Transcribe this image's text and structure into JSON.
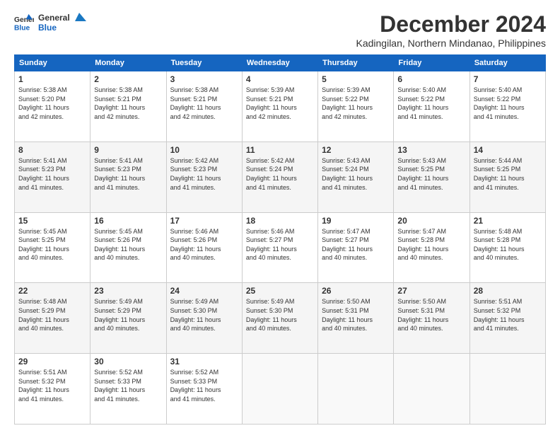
{
  "header": {
    "logo": {
      "line1": "General",
      "line2": "Blue"
    },
    "title": "December 2024",
    "subtitle": "Kadingilan, Northern Mindanao, Philippines"
  },
  "calendar": {
    "days_of_week": [
      "Sunday",
      "Monday",
      "Tuesday",
      "Wednesday",
      "Thursday",
      "Friday",
      "Saturday"
    ],
    "weeks": [
      [
        {
          "day": "1",
          "info": "Sunrise: 5:38 AM\nSunset: 5:20 PM\nDaylight: 11 hours\nand 42 minutes."
        },
        {
          "day": "2",
          "info": "Sunrise: 5:38 AM\nSunset: 5:21 PM\nDaylight: 11 hours\nand 42 minutes."
        },
        {
          "day": "3",
          "info": "Sunrise: 5:38 AM\nSunset: 5:21 PM\nDaylight: 11 hours\nand 42 minutes."
        },
        {
          "day": "4",
          "info": "Sunrise: 5:39 AM\nSunset: 5:21 PM\nDaylight: 11 hours\nand 42 minutes."
        },
        {
          "day": "5",
          "info": "Sunrise: 5:39 AM\nSunset: 5:22 PM\nDaylight: 11 hours\nand 42 minutes."
        },
        {
          "day": "6",
          "info": "Sunrise: 5:40 AM\nSunset: 5:22 PM\nDaylight: 11 hours\nand 41 minutes."
        },
        {
          "day": "7",
          "info": "Sunrise: 5:40 AM\nSunset: 5:22 PM\nDaylight: 11 hours\nand 41 minutes."
        }
      ],
      [
        {
          "day": "8",
          "info": "Sunrise: 5:41 AM\nSunset: 5:23 PM\nDaylight: 11 hours\nand 41 minutes."
        },
        {
          "day": "9",
          "info": "Sunrise: 5:41 AM\nSunset: 5:23 PM\nDaylight: 11 hours\nand 41 minutes."
        },
        {
          "day": "10",
          "info": "Sunrise: 5:42 AM\nSunset: 5:23 PM\nDaylight: 11 hours\nand 41 minutes."
        },
        {
          "day": "11",
          "info": "Sunrise: 5:42 AM\nSunset: 5:24 PM\nDaylight: 11 hours\nand 41 minutes."
        },
        {
          "day": "12",
          "info": "Sunrise: 5:43 AM\nSunset: 5:24 PM\nDaylight: 11 hours\nand 41 minutes."
        },
        {
          "day": "13",
          "info": "Sunrise: 5:43 AM\nSunset: 5:25 PM\nDaylight: 11 hours\nand 41 minutes."
        },
        {
          "day": "14",
          "info": "Sunrise: 5:44 AM\nSunset: 5:25 PM\nDaylight: 11 hours\nand 41 minutes."
        }
      ],
      [
        {
          "day": "15",
          "info": "Sunrise: 5:45 AM\nSunset: 5:25 PM\nDaylight: 11 hours\nand 40 minutes."
        },
        {
          "day": "16",
          "info": "Sunrise: 5:45 AM\nSunset: 5:26 PM\nDaylight: 11 hours\nand 40 minutes."
        },
        {
          "day": "17",
          "info": "Sunrise: 5:46 AM\nSunset: 5:26 PM\nDaylight: 11 hours\nand 40 minutes."
        },
        {
          "day": "18",
          "info": "Sunrise: 5:46 AM\nSunset: 5:27 PM\nDaylight: 11 hours\nand 40 minutes."
        },
        {
          "day": "19",
          "info": "Sunrise: 5:47 AM\nSunset: 5:27 PM\nDaylight: 11 hours\nand 40 minutes."
        },
        {
          "day": "20",
          "info": "Sunrise: 5:47 AM\nSunset: 5:28 PM\nDaylight: 11 hours\nand 40 minutes."
        },
        {
          "day": "21",
          "info": "Sunrise: 5:48 AM\nSunset: 5:28 PM\nDaylight: 11 hours\nand 40 minutes."
        }
      ],
      [
        {
          "day": "22",
          "info": "Sunrise: 5:48 AM\nSunset: 5:29 PM\nDaylight: 11 hours\nand 40 minutes."
        },
        {
          "day": "23",
          "info": "Sunrise: 5:49 AM\nSunset: 5:29 PM\nDaylight: 11 hours\nand 40 minutes."
        },
        {
          "day": "24",
          "info": "Sunrise: 5:49 AM\nSunset: 5:30 PM\nDaylight: 11 hours\nand 40 minutes."
        },
        {
          "day": "25",
          "info": "Sunrise: 5:49 AM\nSunset: 5:30 PM\nDaylight: 11 hours\nand 40 minutes."
        },
        {
          "day": "26",
          "info": "Sunrise: 5:50 AM\nSunset: 5:31 PM\nDaylight: 11 hours\nand 40 minutes."
        },
        {
          "day": "27",
          "info": "Sunrise: 5:50 AM\nSunset: 5:31 PM\nDaylight: 11 hours\nand 40 minutes."
        },
        {
          "day": "28",
          "info": "Sunrise: 5:51 AM\nSunset: 5:32 PM\nDaylight: 11 hours\nand 41 minutes."
        }
      ],
      [
        {
          "day": "29",
          "info": "Sunrise: 5:51 AM\nSunset: 5:32 PM\nDaylight: 11 hours\nand 41 minutes."
        },
        {
          "day": "30",
          "info": "Sunrise: 5:52 AM\nSunset: 5:33 PM\nDaylight: 11 hours\nand 41 minutes."
        },
        {
          "day": "31",
          "info": "Sunrise: 5:52 AM\nSunset: 5:33 PM\nDaylight: 11 hours\nand 41 minutes."
        },
        {
          "day": "",
          "info": ""
        },
        {
          "day": "",
          "info": ""
        },
        {
          "day": "",
          "info": ""
        },
        {
          "day": "",
          "info": ""
        }
      ]
    ]
  }
}
